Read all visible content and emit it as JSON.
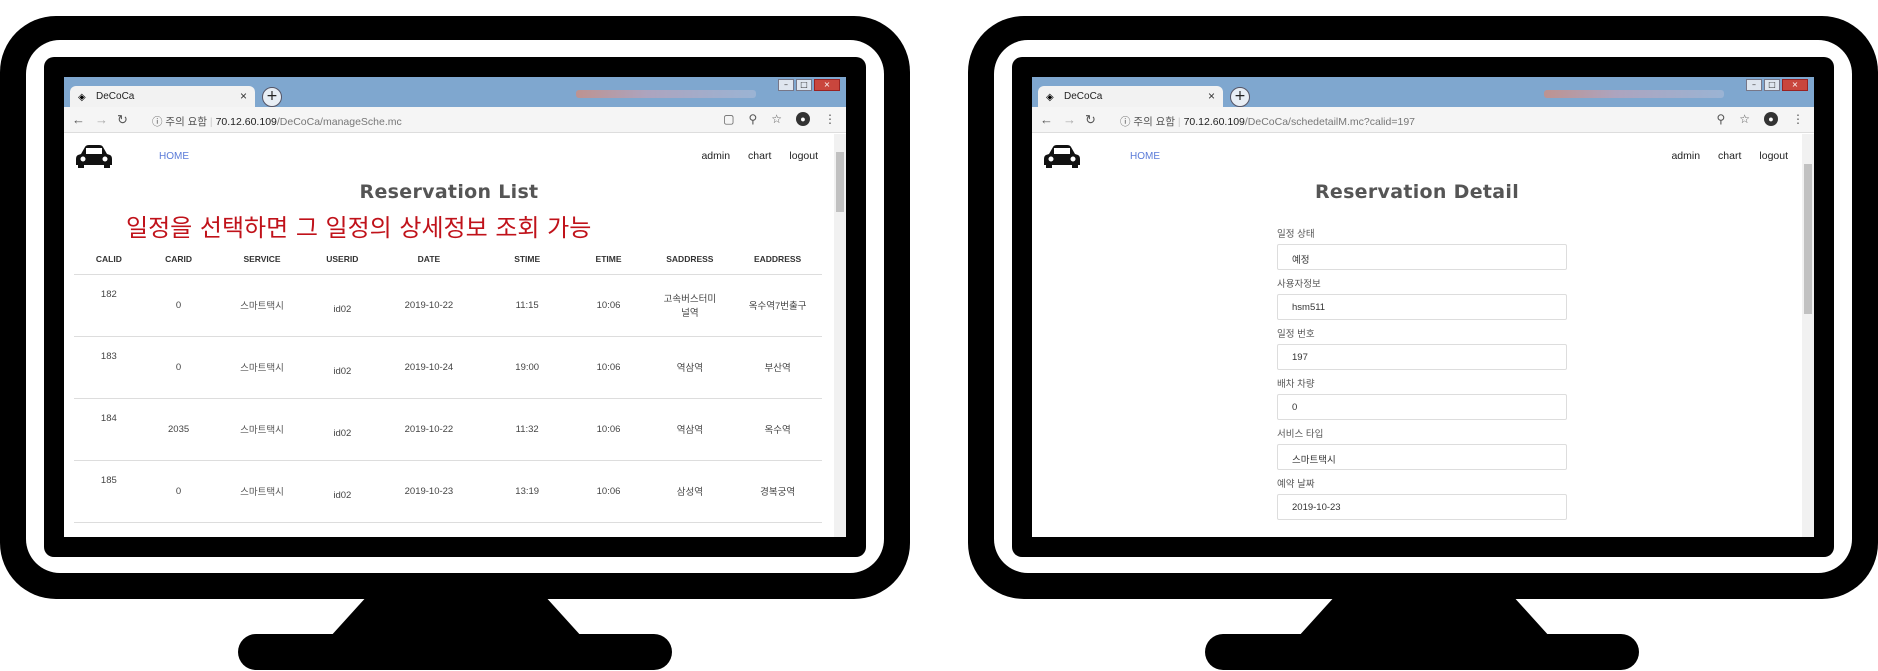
{
  "left_window": {
    "tab_title": "DeCoCa",
    "url_info": "ⓘ 주의 요함",
    "url_host": "70.12.60.109",
    "url_path": "/DeCoCa/manageSche.mc",
    "nav": {
      "home": "HOME",
      "admin": "admin",
      "chart": "chart",
      "logout": "logout"
    },
    "title": "Reservation List",
    "annotation": "일정을 선택하면 그 일정의 상세정보 조회 가능",
    "table": {
      "headers": [
        "CALID",
        "CARID",
        "SERVICE",
        "USERID",
        "DATE",
        "STIME",
        "ETIME",
        "SADDRESS",
        "EADDRESS"
      ],
      "rows": [
        [
          "182",
          "0",
          "스마트택시",
          "id02",
          "2019-10-22",
          "11:15",
          "10:06",
          "고속버스터미널역",
          "옥수역7번출구"
        ],
        [
          "183",
          "0",
          "스마트택시",
          "id02",
          "2019-10-24",
          "19:00",
          "10:06",
          "역삼역",
          "부산역"
        ],
        [
          "184",
          "2035",
          "스마트택시",
          "id02",
          "2019-10-22",
          "11:32",
          "10:06",
          "역삼역",
          "옥수역"
        ],
        [
          "185",
          "0",
          "스마트택시",
          "id02",
          "2019-10-23",
          "13:19",
          "10:06",
          "삼성역",
          "경복궁역"
        ]
      ]
    }
  },
  "right_window": {
    "tab_title": "DeCoCa",
    "url_info": "ⓘ 주의 요함",
    "url_host": "70.12.60.109",
    "url_path": "/DeCoCa/schedetailM.mc?calid=197",
    "nav": {
      "home": "HOME",
      "admin": "admin",
      "chart": "chart",
      "logout": "logout"
    },
    "title": "Reservation Detail",
    "fields": [
      {
        "label": "일정 상태",
        "value": "예정"
      },
      {
        "label": "사용자정보",
        "value": "hsm511"
      },
      {
        "label": "일정 번호",
        "value": "197"
      },
      {
        "label": "배차 차량",
        "value": "0"
      },
      {
        "label": "서비스 타입",
        "value": "스마트택시"
      },
      {
        "label": "예약 날짜",
        "value": "2019-10-23"
      }
    ]
  },
  "colors": {
    "annotation": "#c0121a",
    "home_link": "#5a7bd8",
    "tabbar": "#7fa7cf"
  },
  "icons": [
    "car-logo-icon",
    "back-arrow-icon",
    "forward-arrow-icon",
    "reload-icon",
    "search-icon",
    "star-icon",
    "menu-dots-icon",
    "translate-icon",
    "profile-avatar-icon",
    "close-tab-icon",
    "new-tab-icon"
  ]
}
